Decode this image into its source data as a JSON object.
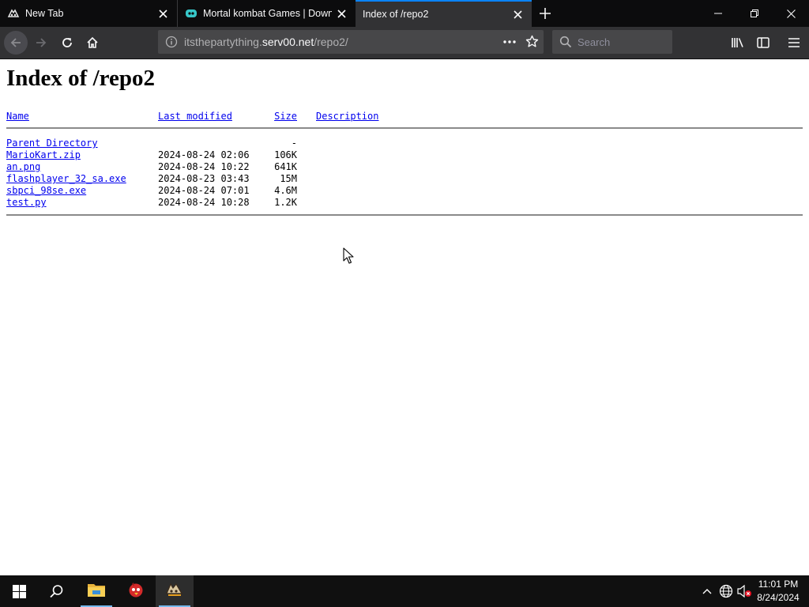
{
  "browser": {
    "tabs": [
      {
        "title": "New Tab",
        "icon": "firefox-icon"
      },
      {
        "title": "Mortal kombat Games | Downl",
        "icon": "site-icon"
      },
      {
        "title": "Index of /repo2",
        "icon": "none"
      }
    ],
    "url": {
      "prefix": "itsthepartything.",
      "domain": "serv00.net",
      "path": "/repo2/"
    },
    "search_placeholder": "Search",
    "accent": "#0a84ff"
  },
  "page": {
    "heading": "Index of /repo2",
    "columns": {
      "name": "Name",
      "modified": "Last modified",
      "size": "Size",
      "description": "Description"
    },
    "parent": {
      "name": "Parent Directory",
      "size": "-"
    },
    "files": [
      {
        "name": "MarioKart.zip",
        "modified": "2024-08-24 02:06",
        "size": "106K"
      },
      {
        "name": "an.png",
        "modified": "2024-08-24 10:22",
        "size": "641K"
      },
      {
        "name": "flashplayer_32_sa.exe",
        "modified": "2024-08-23 03:43",
        "size": "15M"
      },
      {
        "name": "sbpci_98se.exe",
        "modified": "2024-08-24 07:01",
        "size": "4.6M"
      },
      {
        "name": "test.py",
        "modified": "2024-08-24 10:28",
        "size": "1.2K"
      }
    ]
  },
  "taskbar": {
    "time": "11:01 PM",
    "date": "8/24/2024"
  }
}
